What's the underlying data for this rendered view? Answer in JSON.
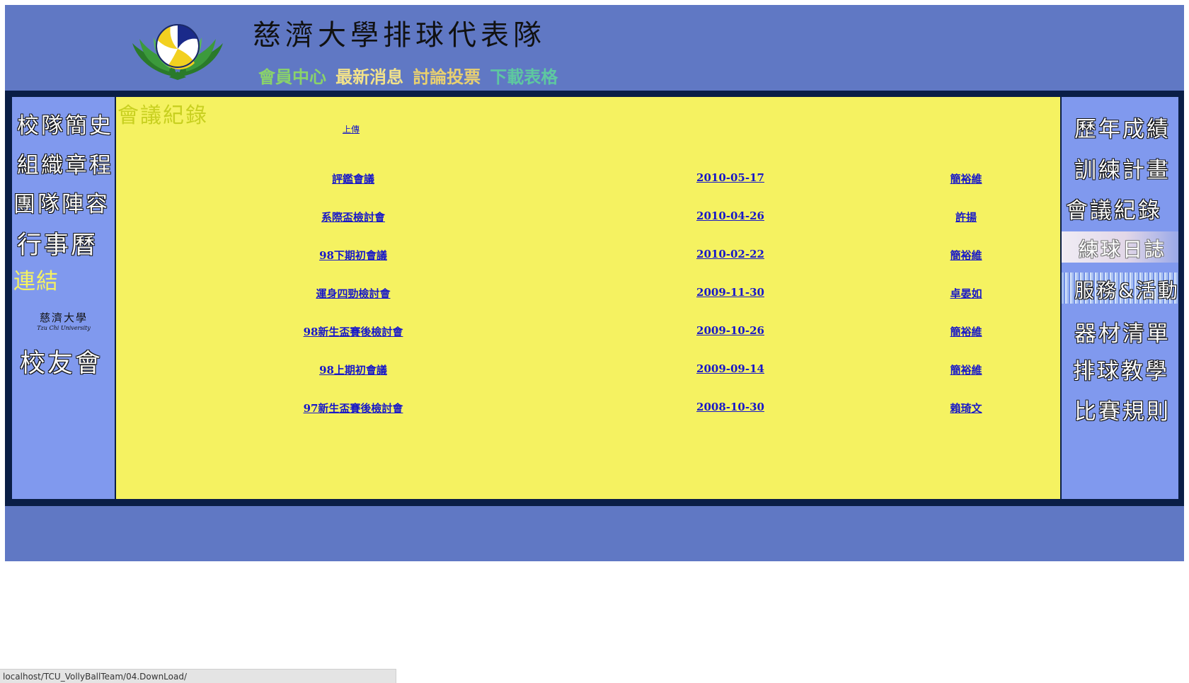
{
  "header": {
    "title": "慈濟大學排球代表隊",
    "nav": [
      {
        "label": "會員中心",
        "color": "#8ad36a"
      },
      {
        "label": "最新消息",
        "color": "#f2e28a"
      },
      {
        "label": "討論投票",
        "color": "#e8d070"
      },
      {
        "label": "下載表格",
        "color": "#5ec8a0"
      }
    ]
  },
  "left_nav": {
    "items": [
      "校隊簡史",
      "組織章程",
      "團隊陣容",
      "行事曆",
      "連結"
    ],
    "tcu_logo": {
      "zh": "慈濟大學",
      "en": "Tzu Chi University"
    },
    "alumni": "校友會"
  },
  "right_nav": {
    "items": [
      "歷年成績",
      "訓練計畫",
      "會議紀錄",
      "練球日誌",
      "服務&活動",
      "器材清單",
      "排球教學",
      "比賽規則"
    ]
  },
  "main": {
    "section_title": "會議紀錄",
    "up_link": "上傳",
    "records": [
      {
        "title": "評鑑會議",
        "date": "2010-05-17",
        "author": "簡裕維"
      },
      {
        "title": "系際盃檢討會",
        "date": "2010-04-26",
        "author": "許揚"
      },
      {
        "title": "98下期初會議",
        "date": "2010-02-22",
        "author": "簡裕維"
      },
      {
        "title": "運身四勁檢討會",
        "date": "2009-11-30",
        "author": "卓晏如"
      },
      {
        "title": "98新生盃賽後檢討會",
        "date": "2009-10-26",
        "author": "簡裕維"
      },
      {
        "title": "98上期初會議",
        "date": "2009-09-14",
        "author": "簡裕維"
      },
      {
        "title": "97新生盃賽後檢討會",
        "date": "2008-10-30",
        "author": "賴琦文"
      }
    ]
  },
  "status_bar": {
    "url": "localhost/TCU_VollyBallTeam/04.DownLoad/"
  },
  "colors": {
    "header_bg": "#6078c4",
    "content_bg": "#f5f261",
    "sidebar_bg": "#8099ee",
    "frame": "#0a1e46",
    "link": "#1818c8"
  }
}
